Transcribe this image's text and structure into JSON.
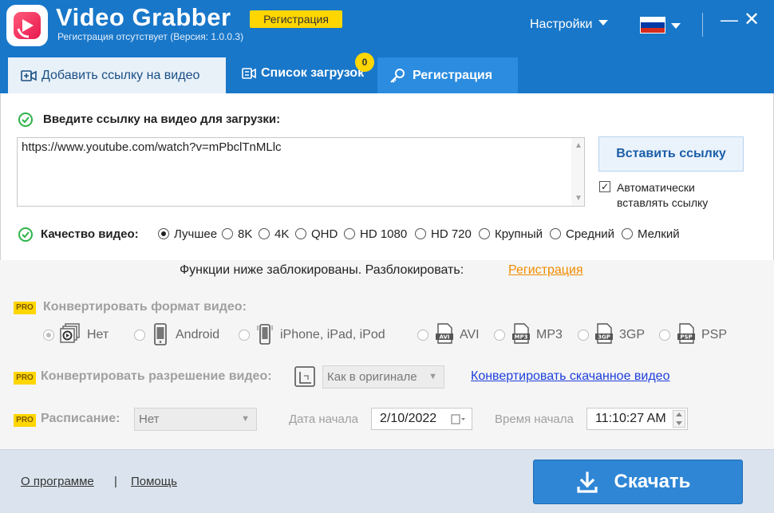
{
  "app": {
    "title": "Video Grabber",
    "registration_badge": "Регистрация",
    "subtitle": "Регистрация отсутствует (Версия: 1.0.0.3)"
  },
  "titlebar": {
    "settings_label": "Настройки",
    "minimize_glyph": "—",
    "close_glyph": "✕",
    "flag_colors": [
      "#ffffff",
      "#0039a6",
      "#d52b1e"
    ]
  },
  "tabs": [
    {
      "label": "Добавить ссылку на видео",
      "active": true,
      "icon": "add-video-icon"
    },
    {
      "label": "Список загрузок",
      "active": false,
      "icon": "download-list-icon"
    },
    {
      "label": "Регистрация",
      "active": false,
      "icon": "key-icon"
    }
  ],
  "downloads_badge": "0",
  "url_section": {
    "label": "Введите ссылку на видео для загрузки:",
    "value": "https://www.youtube.com/watch?v=mPbclTnMLlc",
    "paste_button": "Вставить ссылку",
    "auto_paste_label": "Автоматически вставлять ссылку",
    "auto_paste_checked": "✓"
  },
  "quality": {
    "label": "Качество видео:",
    "options": [
      "Лучшее",
      "8K",
      "4K",
      "QHD",
      "HD 1080",
      "HD 720",
      "Крупный",
      "Средний",
      "Мелкий"
    ],
    "selected": "Лучшее"
  },
  "locked": {
    "message": "Функции ниже заблокированы. Разблокировать:",
    "link": "Регистрация",
    "pro_badge": "PRO",
    "convert_format_label": "Конвертировать формат видео:",
    "formats": [
      "Нет",
      "Android",
      "iPhone, iPad, iPod",
      "AVI",
      "MP3",
      "3GP",
      "PSP"
    ],
    "format_icon_labels": [
      "AVI",
      "MP3",
      "3GP",
      "PSP"
    ],
    "selected_format": "Нет",
    "convert_resolution_label": "Конвертировать разрешение видео:",
    "resolution_value": "Как в оригинале",
    "convert_downloaded_link": "Конвертировать скачанное видео",
    "schedule_label": "Расписание:",
    "schedule_value": "Нет",
    "start_date_label": "Дата начала",
    "start_date_value": "2/10/2022",
    "start_time_label": "Время начала",
    "start_time_value": "11:10:27 AM"
  },
  "footer": {
    "about": "О программе",
    "separator": "|",
    "help": "Помощь",
    "download_button": "Скачать"
  },
  "colors": {
    "titlebar": "#1877c9",
    "accent_yellow": "#ffd600",
    "link_orange": "#f28c00",
    "download_button": "#2f86d5",
    "check_green": "#2db34a"
  }
}
